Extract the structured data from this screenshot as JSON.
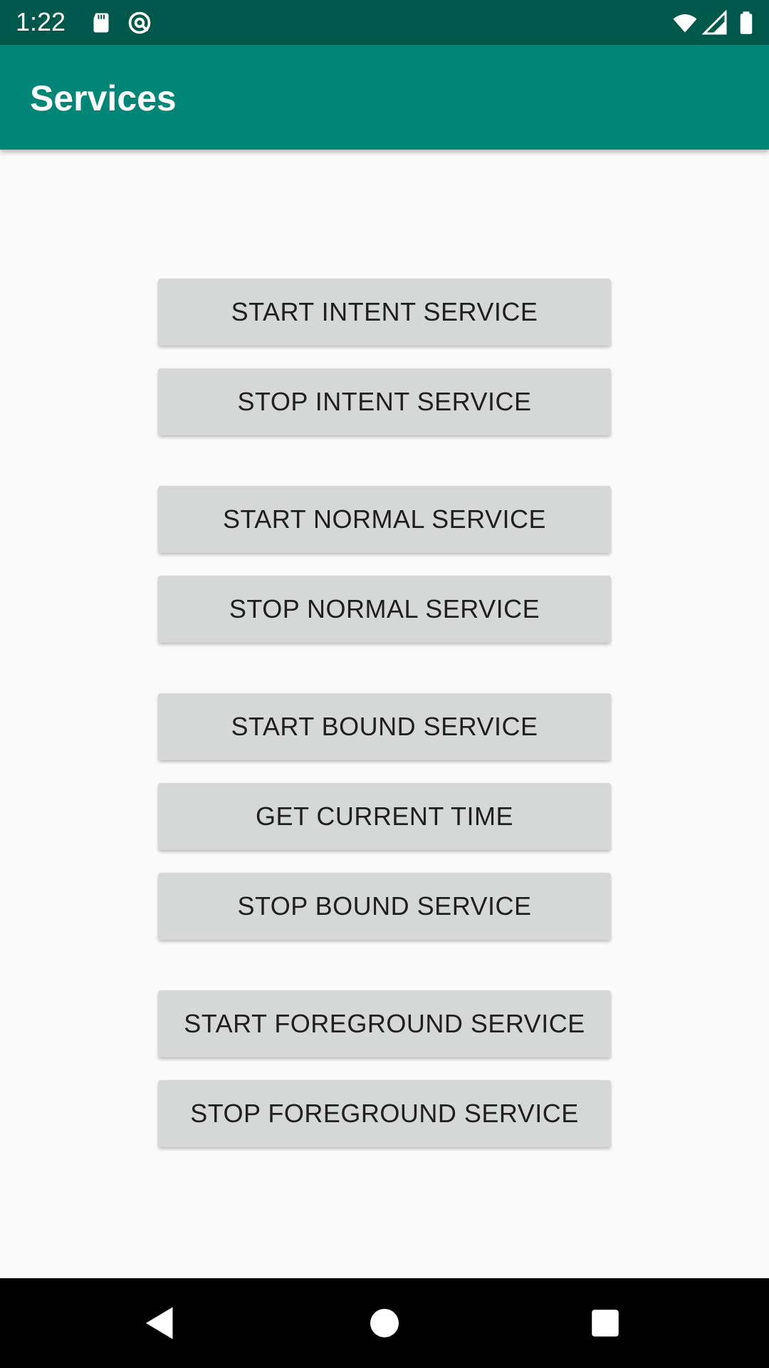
{
  "status_bar": {
    "time": "1:22",
    "icons": [
      "sd-card-icon",
      "at-sign-icon",
      "wifi-icon",
      "cell-signal-icon",
      "battery-icon"
    ]
  },
  "app_bar": {
    "title": "Services",
    "color": "#008577"
  },
  "buttons": {
    "start_intent_service": "START INTENT SERVICE",
    "stop_intent_service": "STOP INTENT SERVICE",
    "start_normal_service": "START NORMAL SERVICE",
    "stop_normal_service": "STOP NORMAL SERVICE",
    "start_bound_service": "START BOUND SERVICE",
    "get_current_time": "GET CURRENT TIME",
    "stop_bound_service": "STOP BOUND SERVICE",
    "start_foreground_service": "START FOREGROUND SERVICE",
    "stop_foreground_service": "STOP FOREGROUND SERVICE"
  },
  "nav_bar": {
    "icons": [
      "back-icon",
      "home-icon",
      "recents-icon"
    ]
  },
  "colors": {
    "status_bar": "#00574b",
    "app_bar": "#008577",
    "button": "#d6d7d7",
    "background": "#fafafa"
  }
}
